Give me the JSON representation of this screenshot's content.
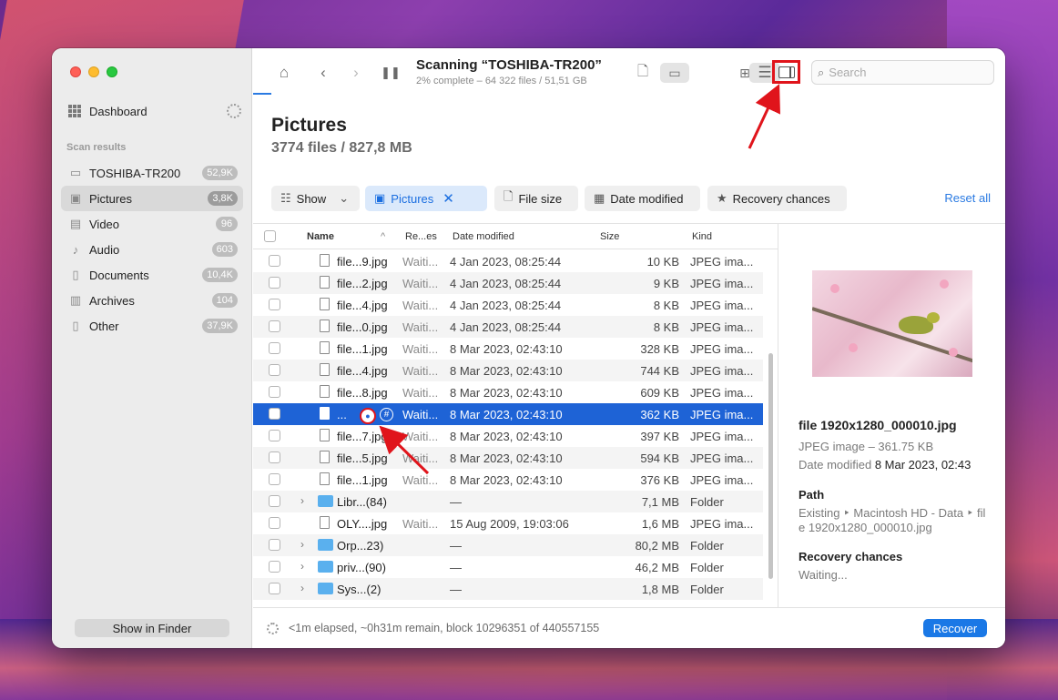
{
  "sidebar": {
    "dashboard_label": "Dashboard",
    "section_label": "Scan results",
    "items": [
      {
        "label": "TOSHIBA-TR200",
        "count": "52,9K",
        "icon": "drive-icon"
      },
      {
        "label": "Pictures",
        "count": "3,8K",
        "icon": "image-icon"
      },
      {
        "label": "Video",
        "count": "96",
        "icon": "film-icon"
      },
      {
        "label": "Audio",
        "count": "603",
        "icon": "music-note-icon"
      },
      {
        "label": "Documents",
        "count": "10,4K",
        "icon": "document-icon"
      },
      {
        "label": "Archives",
        "count": "104",
        "icon": "archive-icon"
      },
      {
        "label": "Other",
        "count": "37,9K",
        "icon": "file-icon"
      }
    ],
    "finder_button": "Show in Finder"
  },
  "toolbar": {
    "title": "Scanning “TOSHIBA-TR200”",
    "subtitle": "2% complete – 64 322 files / 51,51 GB",
    "search_placeholder": "Search"
  },
  "header": {
    "title": "Pictures",
    "subtitle": "3774 files / 827,8 MB"
  },
  "filters": {
    "show": "Show",
    "pictures": "Pictures",
    "file_size": "File size",
    "date_modified": "Date modified",
    "recovery_chances": "Recovery chances",
    "reset_all": "Reset all"
  },
  "table": {
    "columns": {
      "name": "Name",
      "recovery": "Re...es",
      "date": "Date modified",
      "size": "Size",
      "kind": "Kind"
    },
    "rows": [
      {
        "name": "file...9.jpg",
        "rec": "Waiti...",
        "date": "4 Jan 2023, 08:25:44",
        "size": "10 KB",
        "kind": "JPEG ima...",
        "type": "file"
      },
      {
        "name": "file...2.jpg",
        "rec": "Waiti...",
        "date": "4 Jan 2023, 08:25:44",
        "size": "9 KB",
        "kind": "JPEG ima...",
        "type": "file"
      },
      {
        "name": "file...4.jpg",
        "rec": "Waiti...",
        "date": "4 Jan 2023, 08:25:44",
        "size": "8 KB",
        "kind": "JPEG ima...",
        "type": "file"
      },
      {
        "name": "file...0.jpg",
        "rec": "Waiti...",
        "date": "4 Jan 2023, 08:25:44",
        "size": "8 KB",
        "kind": "JPEG ima...",
        "type": "file"
      },
      {
        "name": "file...1.jpg",
        "rec": "Waiti...",
        "date": "8 Mar 2023, 02:43:10",
        "size": "328 KB",
        "kind": "JPEG ima...",
        "type": "file"
      },
      {
        "name": "file...4.jpg",
        "rec": "Waiti...",
        "date": "8 Mar 2023, 02:43:10",
        "size": "744 KB",
        "kind": "JPEG ima...",
        "type": "file"
      },
      {
        "name": "file...8.jpg",
        "rec": "Waiti...",
        "date": "8 Mar 2023, 02:43:10",
        "size": "609 KB",
        "kind": "JPEG ima...",
        "type": "file"
      },
      {
        "name": "...",
        "rec": "Waiti...",
        "date": "8 Mar 2023, 02:43:10",
        "size": "362 KB",
        "kind": "JPEG ima...",
        "type": "file",
        "selected": true
      },
      {
        "name": "file...7.jpg",
        "rec": "Waiti...",
        "date": "8 Mar 2023, 02:43:10",
        "size": "397 KB",
        "kind": "JPEG ima...",
        "type": "file"
      },
      {
        "name": "file...5.jpg",
        "rec": "Waiti...",
        "date": "8 Mar 2023, 02:43:10",
        "size": "594 KB",
        "kind": "JPEG ima...",
        "type": "file"
      },
      {
        "name": "file...1.jpg",
        "rec": "Waiti...",
        "date": "8 Mar 2023, 02:43:10",
        "size": "376 KB",
        "kind": "JPEG ima...",
        "type": "file"
      },
      {
        "name": "Libr...(84)",
        "rec": "",
        "date": "—",
        "size": "7,1 MB",
        "kind": "Folder",
        "type": "folder"
      },
      {
        "name": "OLY....jpg",
        "rec": "Waiti...",
        "date": "15 Aug 2009, 19:03:06",
        "size": "1,6 MB",
        "kind": "JPEG ima...",
        "type": "file"
      },
      {
        "name": "Orp...23)",
        "rec": "",
        "date": "—",
        "size": "80,2 MB",
        "kind": "Folder",
        "type": "folder"
      },
      {
        "name": "priv...(90)",
        "rec": "",
        "date": "—",
        "size": "46,2 MB",
        "kind": "Folder",
        "type": "folder"
      },
      {
        "name": "Sys...(2)",
        "rec": "",
        "date": "—",
        "size": "1,8 MB",
        "kind": "Folder",
        "type": "folder"
      }
    ]
  },
  "preview": {
    "filename": "file 1920x1280_000010.jpg",
    "type_size": "JPEG image – 361.75 KB",
    "date_label": "Date modified",
    "date_value": "8 Mar 2023, 02:43",
    "path_heading": "Path",
    "path_line1": "Existing ‣ Macintosh HD - Data ‣ fil",
    "path_line2": "e 1920x1280_000010.jpg",
    "recovery_heading": "Recovery chances",
    "recovery_value": "Waiting..."
  },
  "status": {
    "text": "<1m elapsed, ~0h31m remain, block 10296351 of 440557155",
    "recover_button": "Recover"
  },
  "colors": {
    "accent": "#1a78e6",
    "selection": "#1e63d6",
    "annotation": "#e0141b"
  }
}
